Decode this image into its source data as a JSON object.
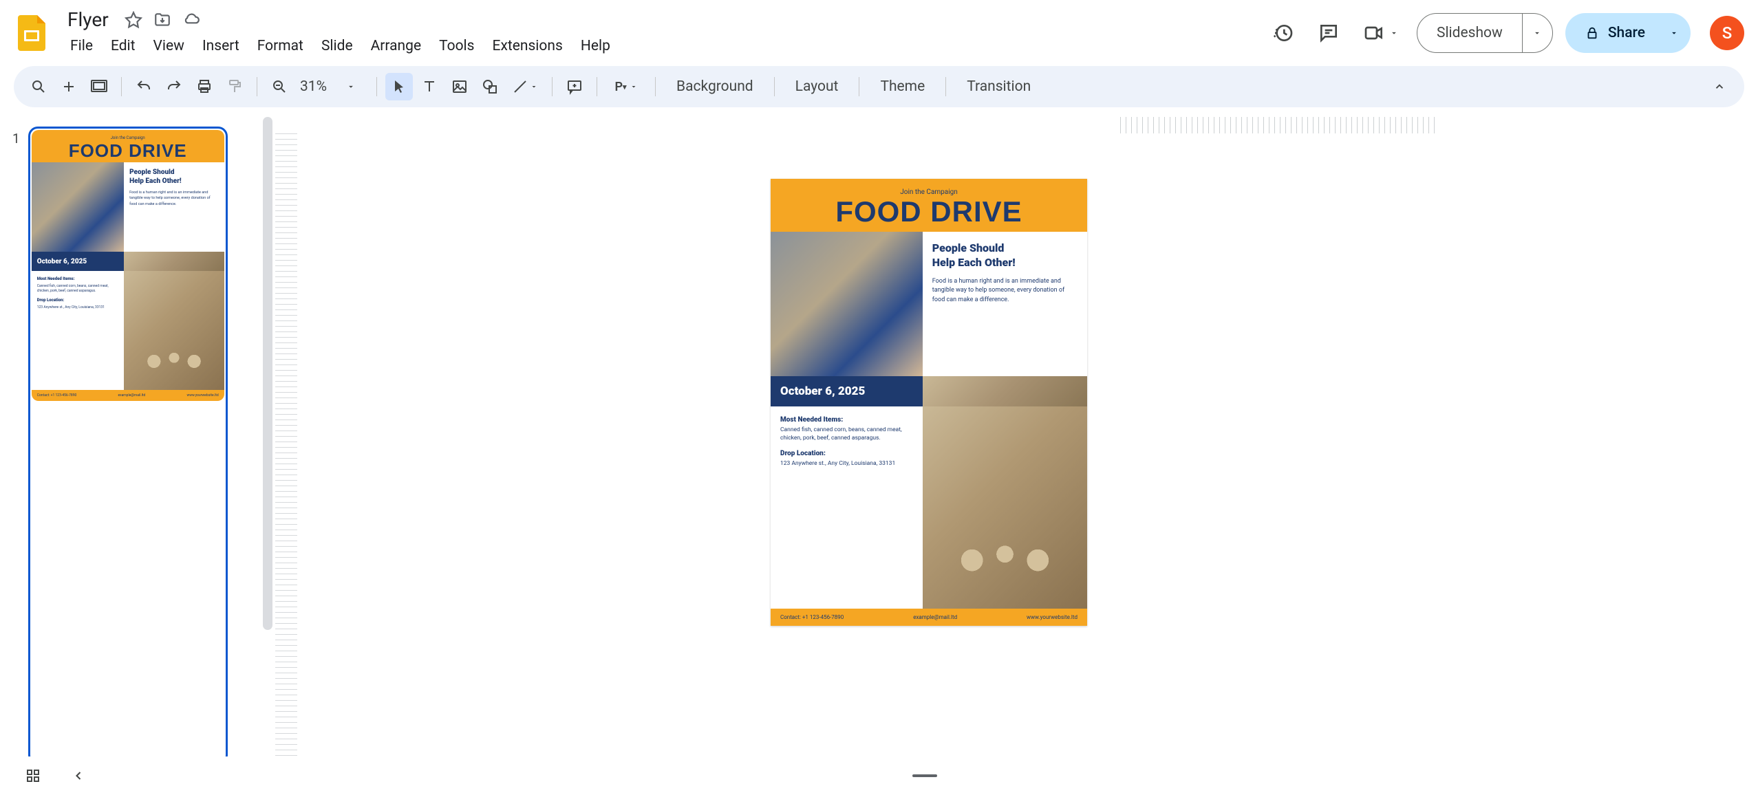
{
  "header": {
    "doc_title": "Flyer",
    "menus": [
      "File",
      "Edit",
      "View",
      "Insert",
      "Format",
      "Slide",
      "Arrange",
      "Tools",
      "Extensions",
      "Help"
    ],
    "slideshow_label": "Slideshow",
    "share_label": "Share",
    "avatar_letter": "S"
  },
  "toolbar": {
    "zoom": "31%",
    "background_label": "Background",
    "layout_label": "Layout",
    "theme_label": "Theme",
    "transition_label": "Transition"
  },
  "filmstrip": {
    "slide_number": "1"
  },
  "flyer": {
    "campaign": "Join the Campaign",
    "title": "FOOD DRIVE",
    "heading_line1": "People Should",
    "heading_line2": "Help Each Other!",
    "paragraph": "Food is a human right and is an immediate and tangible way to help someone, every donation of food can make a difference.",
    "date": "October 6, 2025",
    "items_heading": "Most Needed Items:",
    "items_text": "Canned fish, canned corn, beans, canned meat, chicken, pork, beef, canned asparagus.",
    "drop_heading": "Drop Location:",
    "drop_text": "123 Anywhere st., Any City, Louisiana, 33131",
    "contact": "Contact: +1 123-456-7890",
    "email": "example@mail.ltd",
    "website": "www.yourwebsite.ltd"
  }
}
